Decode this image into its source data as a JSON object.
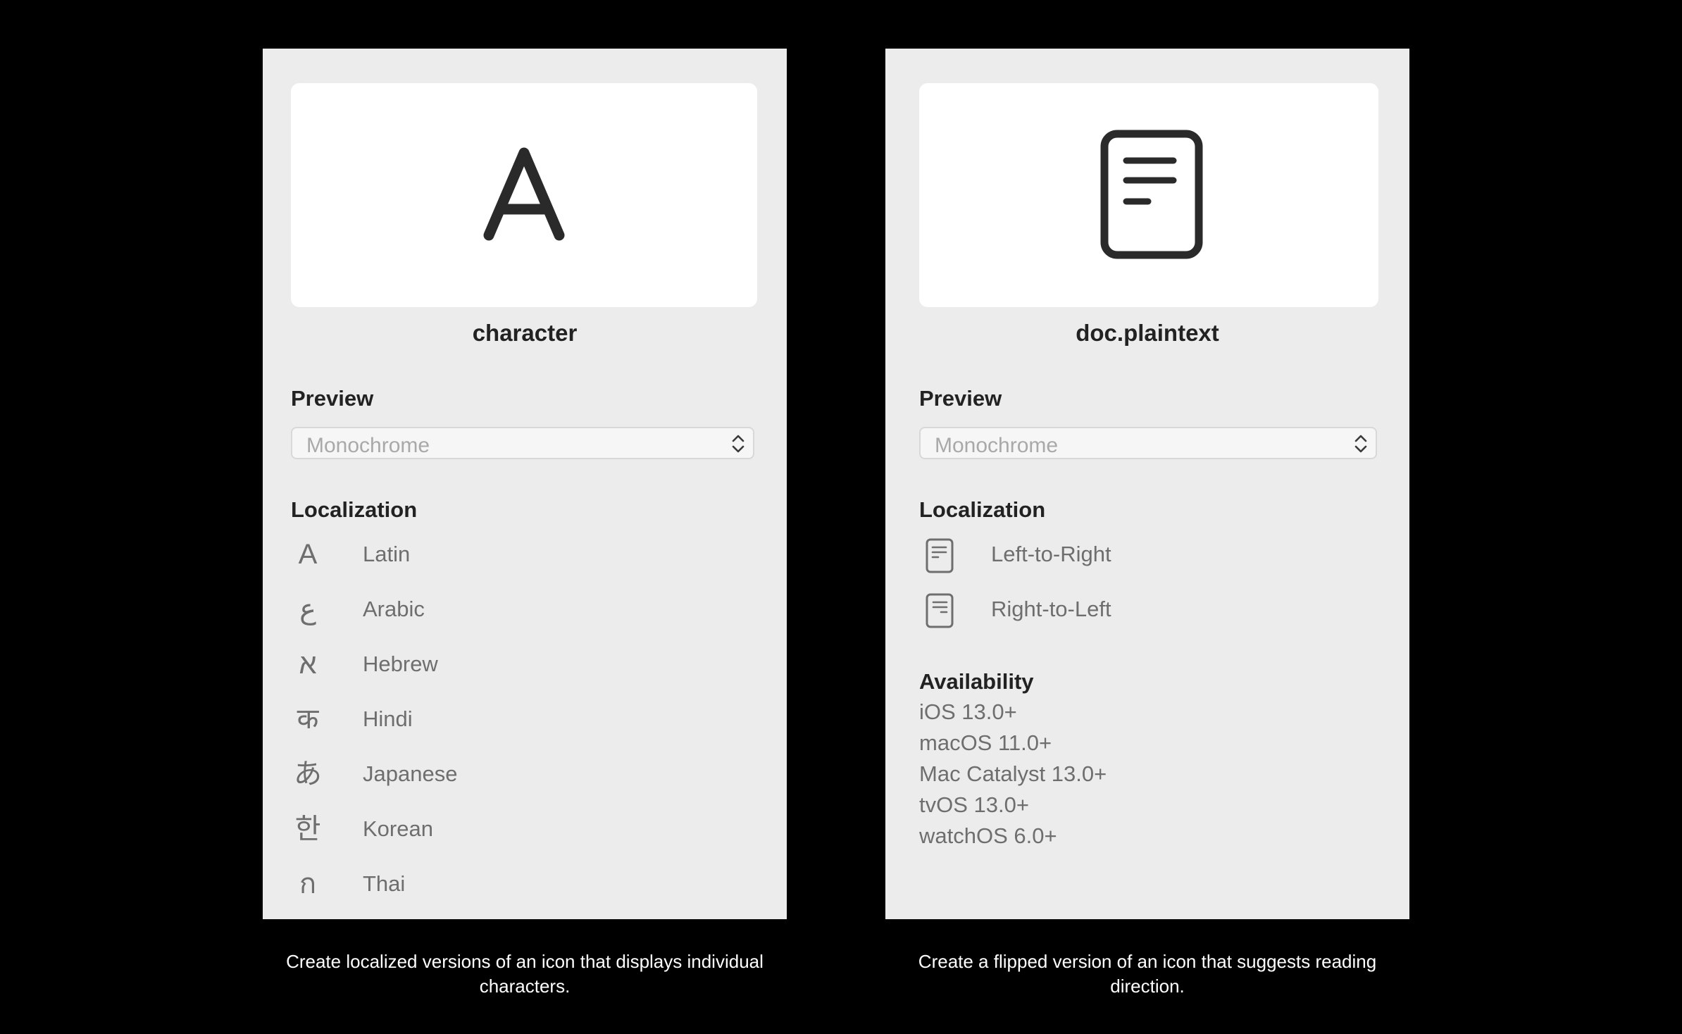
{
  "colors": {
    "background": "#000000",
    "panel": "#ececec",
    "card": "#ffffff",
    "text_strong": "#222222",
    "text_muted": "#6e6e6e",
    "placeholder": "#a9a9a9"
  },
  "left_panel": {
    "preview_glyph": "A",
    "symbol_name": "character",
    "preview_label": "Preview",
    "preview_mode": "Monochrome",
    "localization_label": "Localization",
    "localizations": [
      {
        "glyph": "A",
        "label": "Latin"
      },
      {
        "glyph": "ع",
        "label": "Arabic"
      },
      {
        "glyph": "א",
        "label": "Hebrew"
      },
      {
        "glyph": "क",
        "label": "Hindi"
      },
      {
        "glyph": "あ",
        "label": "Japanese"
      },
      {
        "glyph": "한",
        "label": "Korean"
      },
      {
        "glyph": "ก",
        "label": "Thai"
      }
    ],
    "caption": "Create localized versions of an icon that displays individual characters."
  },
  "right_panel": {
    "preview_icon": "doc-plaintext-icon",
    "symbol_name": "doc.plaintext",
    "preview_label": "Preview",
    "preview_mode": "Monochrome",
    "localization_label": "Localization",
    "localizations": [
      {
        "icon": "doc-plaintext-icon",
        "label": "Left-to-Right"
      },
      {
        "icon": "doc-plaintext-rtl-icon",
        "label": "Right-to-Left"
      }
    ],
    "availability_label": "Availability",
    "availability": [
      "iOS 13.0+",
      "macOS 11.0+",
      "Mac Catalyst 13.0+",
      "tvOS 13.0+",
      "watchOS 6.0+"
    ],
    "caption": "Create a flipped version of an icon that suggests reading direction."
  }
}
